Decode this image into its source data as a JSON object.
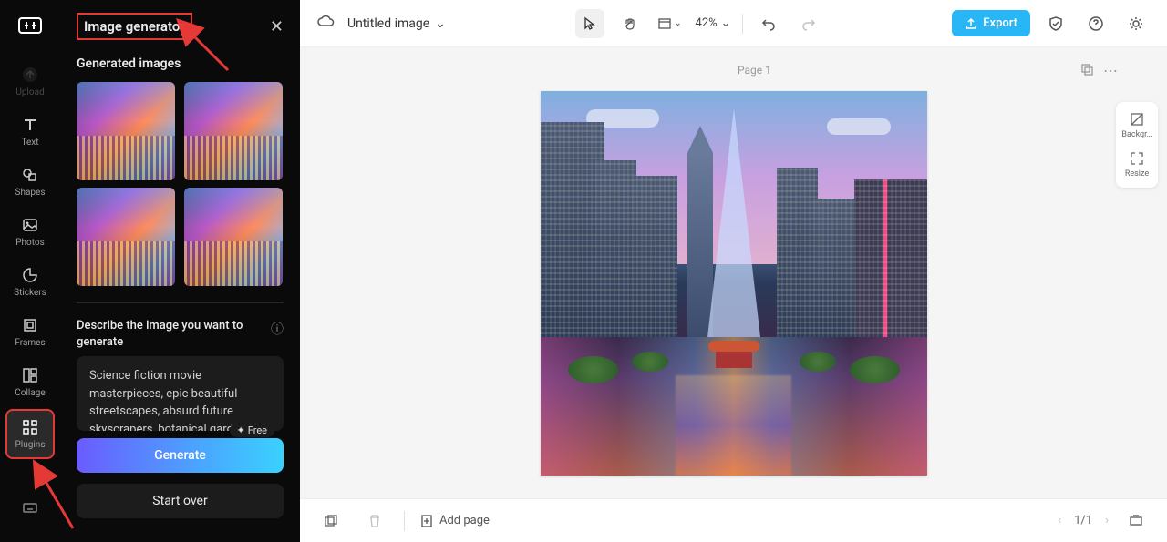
{
  "rail": {
    "upload": "Upload",
    "text": "Text",
    "shapes": "Shapes",
    "photos": "Photos",
    "stickers": "Stickers",
    "frames": "Frames",
    "collage": "Collage",
    "plugins": "Plugins"
  },
  "panel": {
    "title": "Image generator",
    "generated_label": "Generated images",
    "describe_label": "Describe the image you want to generate",
    "prompt": "Science fiction movie masterpieces, epic beautiful streetscapes, absurd future skyscrapers, botanical gardens,",
    "free_badge": "Free",
    "generate": "Generate",
    "start_over": "Start over"
  },
  "topbar": {
    "doc_title": "Untitled image",
    "zoom": "42%",
    "export": "Export"
  },
  "right_tools": {
    "background": "Backgr…",
    "resize": "Resize"
  },
  "canvas": {
    "page_label": "Page 1"
  },
  "bottombar": {
    "add_page": "Add page",
    "pager": "1/1"
  }
}
